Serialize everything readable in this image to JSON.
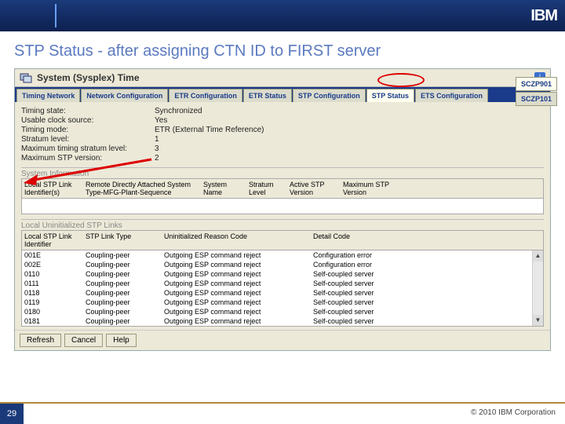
{
  "slide": {
    "title": "STP Status - after assigning CTN ID to FIRST server",
    "page": "29",
    "copyright": "© 2010 IBM Corporation",
    "logo": "IBM"
  },
  "window": {
    "title": "System (Sysplex) Time",
    "info": "i"
  },
  "tabs": [
    "Timing Network",
    "Network Configuration",
    "ETR Configuration",
    "ETR Status",
    "STP Configuration",
    "STP Status",
    "ETS Configuration"
  ],
  "activeTab": 5,
  "sideTabs": [
    "SCZP901",
    "SCZP101"
  ],
  "activeSide": 0,
  "status": {
    "k0": "Timing state:",
    "v0": "Synchronized",
    "k1": "Usable clock source:",
    "v1": "Yes",
    "k2": "Timing mode:",
    "v2": "ETR (External Time Reference)",
    "k3": "Stratum level:",
    "v3": "1",
    "k4": "Maximum timing stratum level:",
    "v4": "3",
    "k5": "Maximum STP version:",
    "v5": "2"
  },
  "sysinfo": {
    "label": "System Information",
    "h0": "Local STP Link Identifier(s)",
    "h1": "Remote Directly Attached System Type-MFG-Plant-Sequence",
    "h2": "System Name",
    "h3": "Stratum Level",
    "h4": "Active STP Version",
    "h5": "Maximum STP Version"
  },
  "uninit": {
    "label": "Local Uninitialized STP Links",
    "h0": "Local STP Link Identifier",
    "h1": "STP Link Type",
    "h2": "Uninitialized Reason Code",
    "h3": "Detail Code",
    "rows": [
      {
        "id": "001E",
        "type": "Coupling-peer",
        "reason": "Outgoing ESP command reject",
        "detail": "Configuration error"
      },
      {
        "id": "002E",
        "type": "Coupling-peer",
        "reason": "Outgoing ESP command reject",
        "detail": "Configuration error"
      },
      {
        "id": "0110",
        "type": "Coupling-peer",
        "reason": "Outgoing ESP command reject",
        "detail": "Self-coupled server"
      },
      {
        "id": "0111",
        "type": "Coupling-peer",
        "reason": "Outgoing ESP command reject",
        "detail": "Self-coupled server"
      },
      {
        "id": "0118",
        "type": "Coupling-peer",
        "reason": "Outgoing ESP command reject",
        "detail": "Self-coupled server"
      },
      {
        "id": "0119",
        "type": "Coupling-peer",
        "reason": "Outgoing ESP command reject",
        "detail": "Self-coupled server"
      },
      {
        "id": "0180",
        "type": "Coupling-peer",
        "reason": "Outgoing ESP command reject",
        "detail": "Self-coupled server"
      },
      {
        "id": "0181",
        "type": "Coupling-peer",
        "reason": "Outgoing ESP command reject",
        "detail": "Self-coupled server"
      }
    ]
  },
  "buttons": {
    "refresh": "Refresh",
    "cancel": "Cancel",
    "help": "Help"
  }
}
